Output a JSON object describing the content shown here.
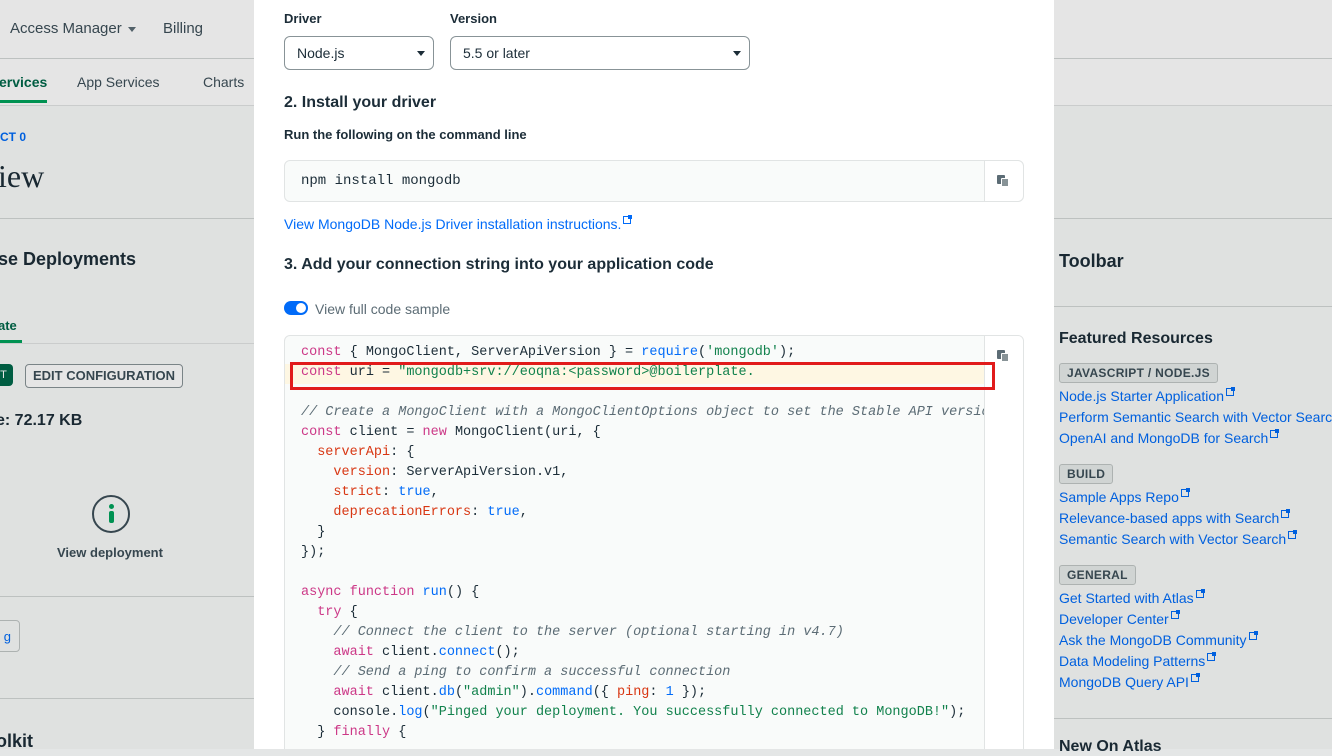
{
  "background": {
    "topbar": {
      "access_manager": "Access Manager",
      "billing": "Billing"
    },
    "nav": {
      "services": "ervices",
      "app_services": "App Services",
      "charts": "Charts"
    },
    "left": {
      "project": "CT 0",
      "title": "iew",
      "section": "se Deployments",
      "create_tab": "ate",
      "edit_config": "EDIT CONFIGURATION",
      "green_btn": "T",
      "size": "e: 72.17 KB",
      "view_deployment": "View deployment",
      "small_box": "g",
      "toolkit": "olkit"
    },
    "right": {
      "toolbar": "Toolbar",
      "featured": "Featured Resources",
      "groups": [
        {
          "badge": "JAVASCRIPT / NODE.JS",
          "links": [
            "Node.js Starter Application",
            "Perform Semantic Search with Vector Search",
            "OpenAI and MongoDB for Search"
          ]
        },
        {
          "badge": "BUILD",
          "links": [
            "Sample Apps Repo",
            "Relevance-based apps with Search",
            "Semantic Search with Vector Search"
          ]
        },
        {
          "badge": "GENERAL",
          "links": [
            "Get Started with Atlas",
            "Developer Center",
            "Ask the MongoDB Community",
            "Data Modeling Patterns",
            "MongoDB Query API"
          ]
        }
      ],
      "new_on_atlas": "New On Atlas"
    }
  },
  "modal": {
    "driver": {
      "label": "Driver",
      "value": "Node.js"
    },
    "version": {
      "label": "Version",
      "value": "5.5 or later"
    },
    "step2": {
      "title": "2. Install your driver",
      "subtitle": "Run the following on the command line",
      "command": "npm install mongodb",
      "doc_link": "View MongoDB Node.js Driver installation instructions."
    },
    "step3": {
      "title": "3. Add your connection string into your application code",
      "toggle_label": "View full code sample"
    },
    "colors": {
      "accent": "#016bf8",
      "highlight": "#e11b1b"
    }
  }
}
